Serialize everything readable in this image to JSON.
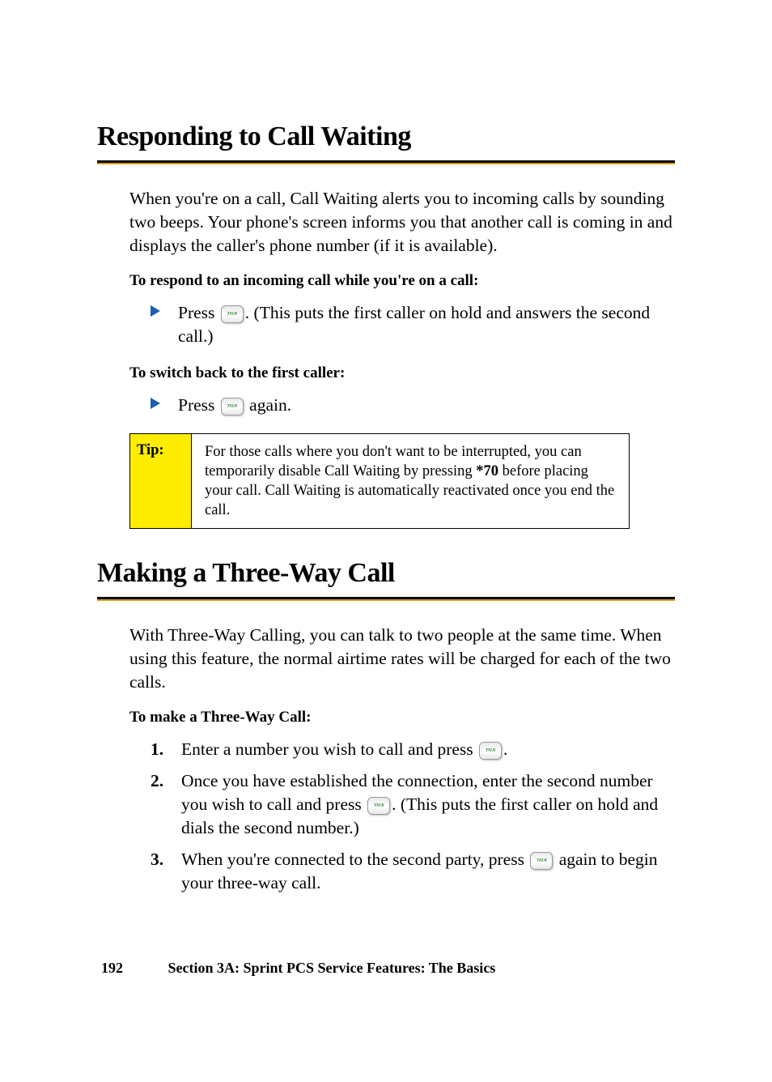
{
  "section1": {
    "heading": "Responding to Call Waiting",
    "intro": "When you're on a call, Call Waiting alerts you to incoming calls by sounding two beeps. Your phone's screen informs you that another call is coming in and displays the caller's phone number (if it is available).",
    "sub1": "To respond to an incoming call while you're on a call:",
    "bullet1_pre": "Press ",
    "bullet1_post": ". (This puts the first caller on hold and answers the second call.)",
    "sub2": "To switch back to the first caller:",
    "bullet2_pre": "Press ",
    "bullet2_post": " again.",
    "tip_label": "Tip:",
    "tip_text_pre": "For those calls where you don't want to be interrupted, you can temporarily disable Call Waiting by pressing ",
    "tip_bold": "*70",
    "tip_text_post": " before placing your call. Call Waiting is automatically reactivated once you end the call."
  },
  "section2": {
    "heading": "Making a Three-Way Call",
    "intro": "With Three-Way Calling, you can talk to two people at the same time. When using this feature, the normal airtime rates will be charged for each of the two calls.",
    "sub1": "To make a Three-Way Call:",
    "step1_pre": "Enter a number you wish to call and press ",
    "step1_post": ".",
    "step2_pre": "Once you have established the connection, enter the second number you wish to call and press ",
    "step2_post": ". (This puts the first caller on hold and dials the second number.)",
    "step3_pre": "When you're connected to the second party, press ",
    "step3_post": " again to begin your three-way call."
  },
  "footer": {
    "page": "192",
    "section": "Section 3A: Sprint PCS Service Features: The Basics"
  }
}
